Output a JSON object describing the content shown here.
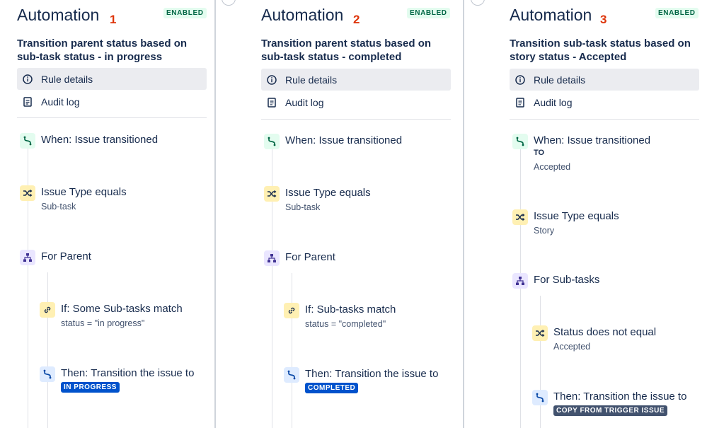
{
  "panels": [
    {
      "title": "Automation",
      "number": "1",
      "badge": "ENABLED",
      "rule_name": "Transition parent status based on sub-task status - in progress",
      "menu": {
        "rule_details": "Rule details",
        "audit_log": "Audit log"
      },
      "components": [
        {
          "icon": "branch-icon",
          "title": "When: Issue transitioned"
        },
        {
          "icon": "shuffle-icon",
          "title": "Issue Type equals",
          "sub": "Sub-task"
        },
        {
          "icon": "hierarchy-icon",
          "title": "For Parent"
        },
        {
          "icon": "link-icon",
          "title": "If: Some Sub-tasks match",
          "sub": "status = \"in progress\""
        },
        {
          "icon": "branch-icon",
          "title": "Then: Transition the issue to",
          "lozenge": "IN PROGRESS"
        }
      ]
    },
    {
      "title": "Automation",
      "number": "2",
      "badge": "ENABLED",
      "rule_name": "Transition parent status based on sub-task status - completed",
      "menu": {
        "rule_details": "Rule details",
        "audit_log": "Audit log"
      },
      "components": [
        {
          "icon": "branch-icon",
          "title": "When: Issue transitioned"
        },
        {
          "icon": "shuffle-icon",
          "title": "Issue Type equals",
          "sub": "Sub-task"
        },
        {
          "icon": "hierarchy-icon",
          "title": "For Parent"
        },
        {
          "icon": "link-icon",
          "title": "If: Sub-tasks match",
          "sub": "status = \"completed\""
        },
        {
          "icon": "branch-icon",
          "title": "Then: Transition the issue to",
          "lozenge": "COMPLETED"
        }
      ]
    },
    {
      "title": "Automation",
      "number": "3",
      "badge": "ENABLED",
      "rule_name": "Transition sub-task status based on story status - Accepted",
      "menu": {
        "rule_details": "Rule details",
        "audit_log": "Audit log"
      },
      "components": [
        {
          "icon": "branch-icon",
          "title": "When: Issue transitioned",
          "label": "TO",
          "sub": "Accepted"
        },
        {
          "icon": "shuffle-icon",
          "title": "Issue Type equals",
          "sub": "Story"
        },
        {
          "icon": "hierarchy-icon",
          "title": "For Sub-tasks"
        },
        {
          "icon": "shuffle-icon",
          "title": "Status does not equal",
          "sub": "Accepted"
        },
        {
          "icon": "branch-icon",
          "title": "Then: Transition the issue to",
          "lozenge": "COPY FROM TRIGGER ISSUE"
        }
      ]
    }
  ]
}
